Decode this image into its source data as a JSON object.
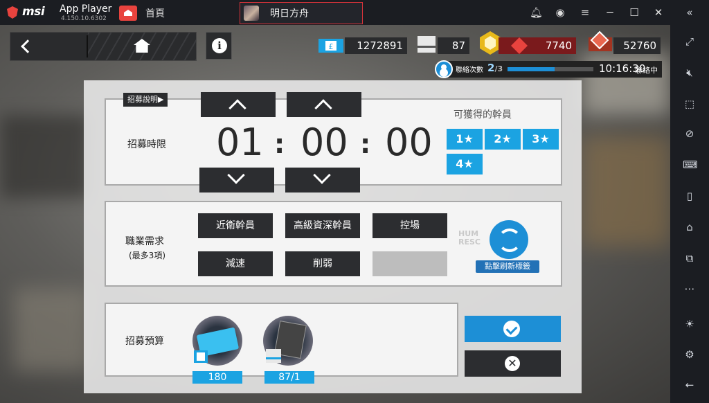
{
  "emulator": {
    "brand": "msi",
    "app_name": "App Player",
    "version": "4.150.10.6302",
    "tabs": [
      {
        "label": "首頁"
      },
      {
        "label": "明日方舟"
      }
    ]
  },
  "resources": {
    "orundum": "1272891",
    "permit": "87",
    "originium": "7740",
    "stone": "52760"
  },
  "link": {
    "label": "聯絡次數",
    "count": "2",
    "count_total": "/3",
    "progress_percent": 55,
    "time": "10:16:30",
    "status": "聯絡中"
  },
  "recruit": {
    "info_tag": "招募說明▶",
    "time_label": "招募時限",
    "hours": "01",
    "minutes": "00",
    "seconds": "00",
    "colon": ":",
    "obtainable_label": "可獲得的幹員",
    "stars": [
      "1★",
      "2★",
      "3★",
      "4★"
    ],
    "tags_label": "職業需求",
    "tags_hint": "(最多3項)",
    "tags": [
      "近衛幹員",
      "高級資深幹員",
      "控場",
      "減速",
      "削弱",
      ""
    ],
    "refresh_label": "點擊刷新標籤",
    "budget_label": "招募預算",
    "budget_items": [
      {
        "qty": "180"
      },
      {
        "qty": "87/1"
      }
    ]
  },
  "colors": {
    "accent_blue": "#1ba3e2",
    "dark_button": "#2c2d30",
    "tab_border": "#d8333a"
  }
}
